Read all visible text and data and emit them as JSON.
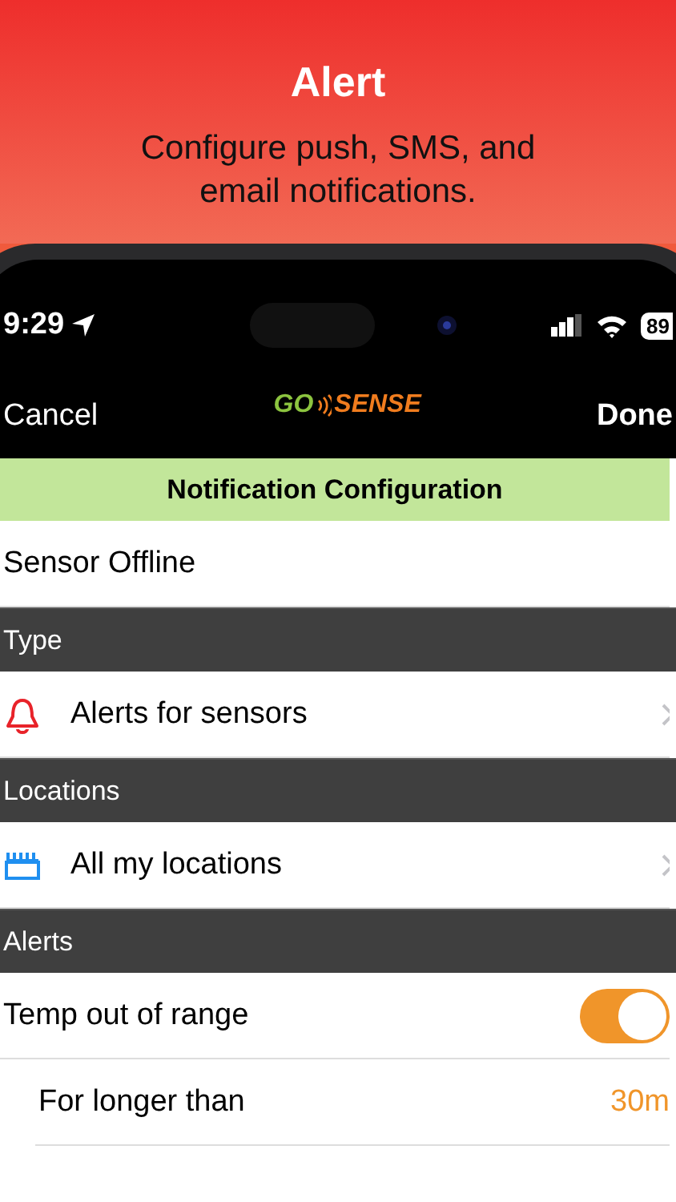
{
  "header": {
    "title": "Alert",
    "subtitle": "Configure push, SMS, and email notifications."
  },
  "status_bar": {
    "time": "9:29",
    "battery": "89"
  },
  "nav": {
    "left": "Cancel",
    "logo_left": "GO",
    "logo_right": "SENSE",
    "right": "Done"
  },
  "banner": "Notification Configuration",
  "rows": [
    {
      "kind": "text",
      "label": "Sensor Offline"
    },
    {
      "kind": "section",
      "label": "Type"
    },
    {
      "kind": "alertlink",
      "label": "Alerts for sensors"
    },
    {
      "kind": "section",
      "label": "Locations"
    },
    {
      "kind": "placelink",
      "label": "All my locations"
    },
    {
      "kind": "section",
      "label": "Alerts"
    },
    {
      "kind": "toggle",
      "label": "Temp out of range",
      "on": true
    },
    {
      "kind": "value",
      "label": "For longer than",
      "value": "30m"
    }
  ]
}
